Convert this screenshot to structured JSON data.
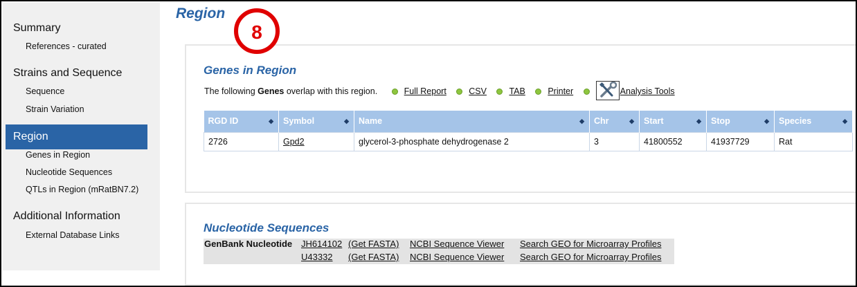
{
  "sidebar": {
    "items": [
      {
        "label": "Summary",
        "sub": [
          "References - curated"
        ]
      },
      {
        "label": "Strains and Sequence",
        "sub": [
          "Sequence",
          "Strain Variation"
        ]
      },
      {
        "label": "Region",
        "sub": [
          "Genes in Region",
          "Nucleotide Sequences",
          "QTLs in Region (mRatBN7.2)"
        ]
      },
      {
        "label": "Additional Information",
        "sub": [
          "External Database Links"
        ]
      }
    ]
  },
  "page": {
    "title": "Region"
  },
  "callout": {
    "number": "8",
    "color": "#e00000"
  },
  "genes": {
    "title": "Genes in Region",
    "intro_prefix": "The following",
    "intro_bold": "Genes",
    "intro_suffix": "overlap with this region.",
    "links": [
      "Full Report",
      "CSV",
      "TAB",
      "Printer"
    ],
    "tools_label": "Analysis Tools",
    "tools_icon": "wrench-screwdriver-icon",
    "columns": [
      "RGD ID",
      "Symbol",
      "Name",
      "Chr",
      "Start",
      "Stop",
      "Species"
    ],
    "rows": [
      [
        "2726",
        "Gpd2",
        "glycerol-3-phosphate dehydrogenase 2",
        "3",
        "41800552",
        "41937729",
        "Rat"
      ]
    ]
  },
  "nucleotide": {
    "title": "Nucleotide Sequences",
    "label": "GenBank Nucleotide",
    "rows": [
      {
        "accession": "JH614102",
        "fasta": "(Get FASTA)",
        "viewer": "NCBI Sequence Viewer",
        "geo": "Search GEO for Microarray Profiles"
      },
      {
        "accession": "U43332",
        "fasta": "(Get FASTA)",
        "viewer": "NCBI Sequence Viewer",
        "geo": "Search GEO for Microarray Profiles"
      }
    ]
  },
  "colors": {
    "accent": "#2a64a6",
    "header_bg": "#a5c4e8",
    "dot": "#8ec63f"
  }
}
